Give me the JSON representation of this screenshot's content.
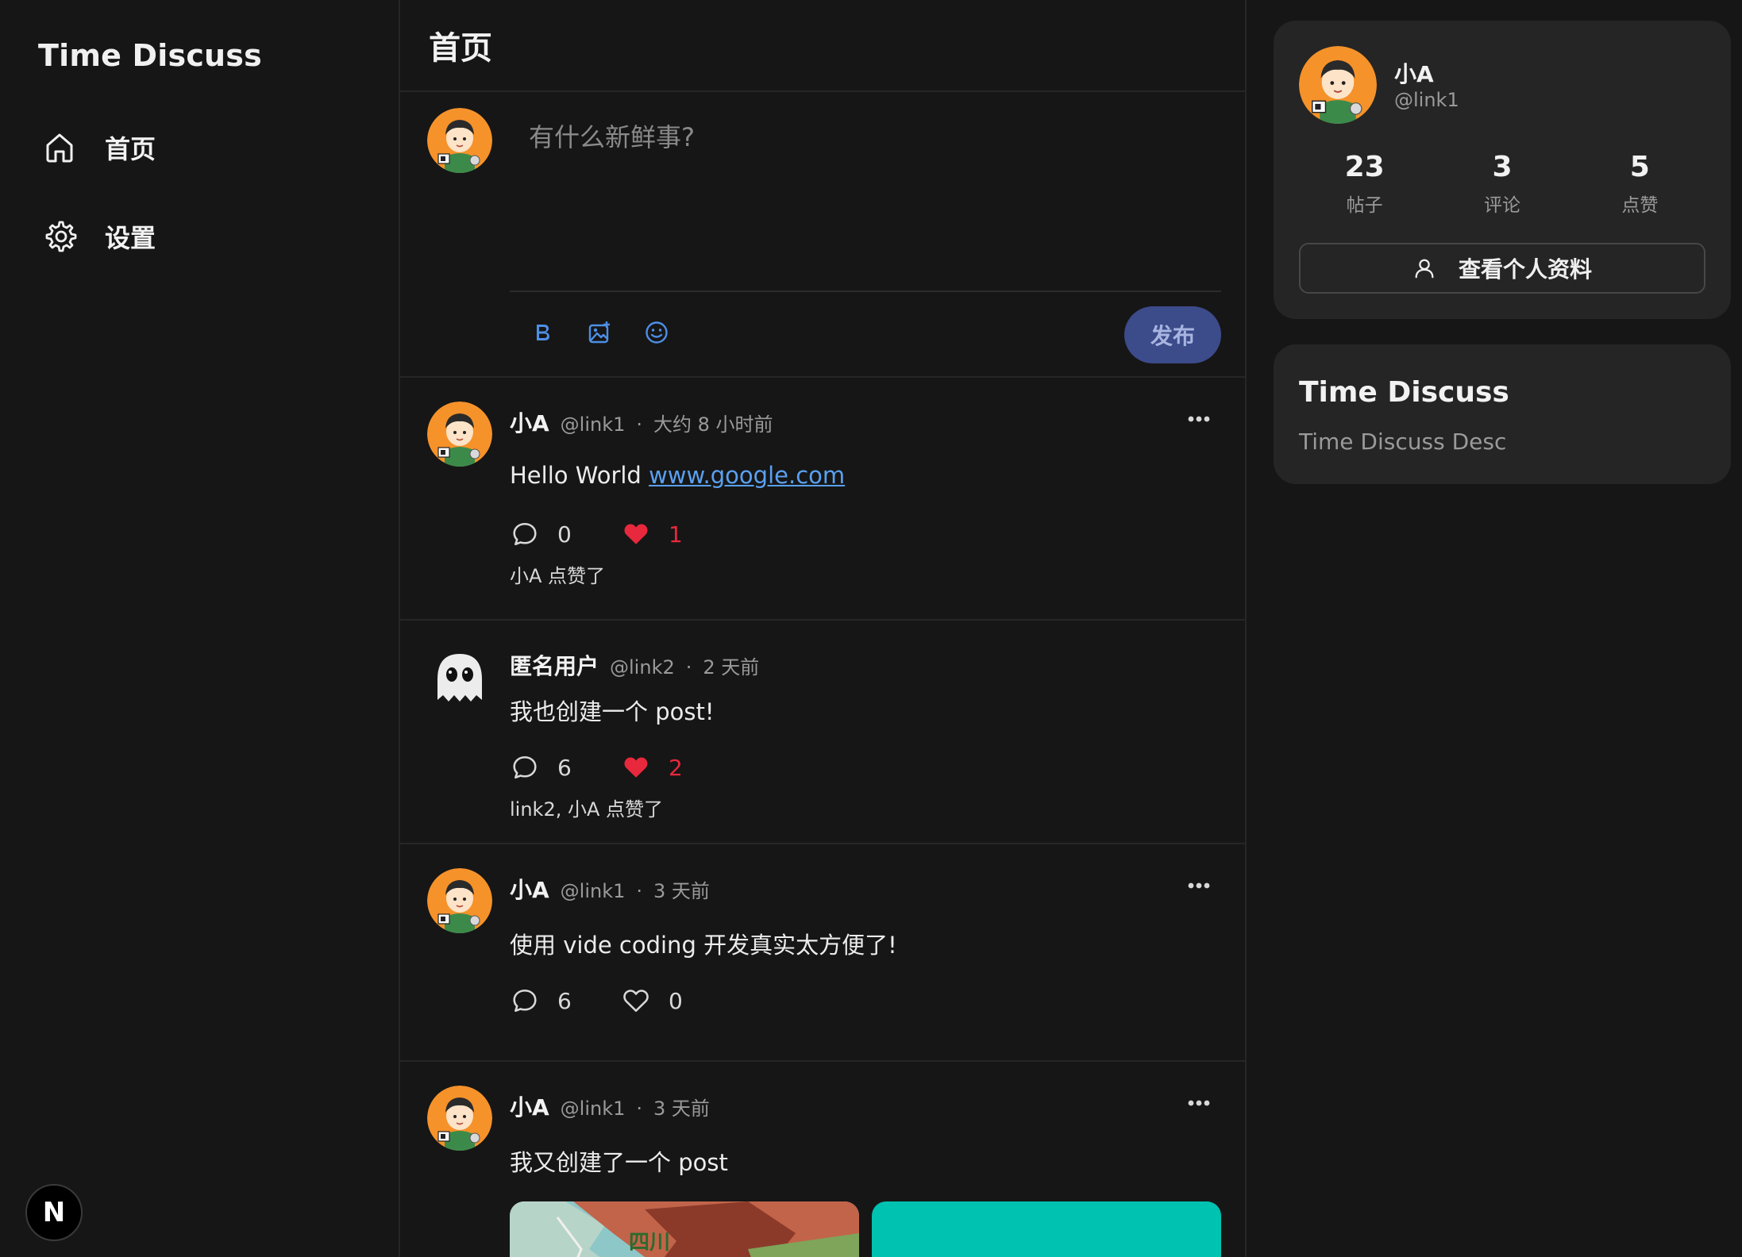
{
  "sidebar": {
    "brand": "Time Discuss",
    "nav": [
      {
        "label": "首页",
        "icon": "home-icon"
      },
      {
        "label": "设置",
        "icon": "gear-icon"
      }
    ],
    "badge": "N"
  },
  "main": {
    "title": "首页",
    "composer": {
      "placeholder": "有什么新鲜事?",
      "publish_label": "发布",
      "tools": [
        "bold-icon",
        "image-add-icon",
        "emoji-icon"
      ]
    },
    "posts": [
      {
        "name": "小A",
        "handle": "@link1",
        "time": "大约 8 小时前",
        "text_prefix": "Hello World ",
        "link": "www.google.com",
        "comments": "0",
        "likes": "1",
        "liked": true,
        "likers": "小A 点赞了",
        "avatar": "cartoon-avatar",
        "more": true
      },
      {
        "name": "匿名用户",
        "handle": "@link2",
        "time": "2 天前",
        "text": "我也创建一个 post!",
        "comments": "6",
        "likes": "2",
        "liked": true,
        "likers": "link2, 小A 点赞了",
        "avatar": "ghost-avatar",
        "more": false
      },
      {
        "name": "小A",
        "handle": "@link1",
        "time": "3 天前",
        "text": "使用 vide coding 开发真实太方便了!",
        "comments": "6",
        "likes": "0",
        "liked": false,
        "avatar": "cartoon-avatar",
        "more": true
      },
      {
        "name": "小A",
        "handle": "@link1",
        "time": "3 天前",
        "text": "我又创建了一个 post",
        "avatar": "cartoon-avatar",
        "more": true,
        "image_label": "四川"
      }
    ],
    "dot": "·"
  },
  "right": {
    "profile": {
      "name": "小A",
      "handle": "@link1",
      "stats": [
        {
          "value": "23",
          "label": "帖子"
        },
        {
          "value": "3",
          "label": "评论"
        },
        {
          "value": "5",
          "label": "点赞"
        }
      ],
      "button_label": "查看个人资料"
    },
    "about": {
      "title": "Time Discuss",
      "desc": "Time Discuss Desc"
    }
  },
  "colors": {
    "background": "#161616",
    "card": "#252525",
    "accent": "#3c4b8a",
    "like_red": "#e8283c",
    "link_blue": "#5aa0f0",
    "tool_blue": "#4d8fe6",
    "avatar_orange": "#f6922a"
  }
}
